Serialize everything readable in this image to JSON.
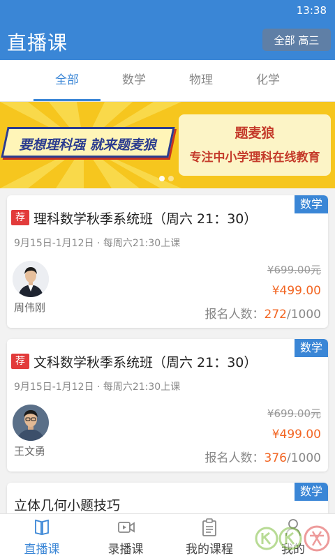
{
  "status": {
    "time": "13:38"
  },
  "header": {
    "title": "直播课",
    "filter_label": "全部 高三"
  },
  "tabs": [
    {
      "label": "全部",
      "active": true
    },
    {
      "label": "数学",
      "active": false
    },
    {
      "label": "物理",
      "active": false
    },
    {
      "label": "化学",
      "active": false
    }
  ],
  "banner": {
    "slogan": "要想理科强 就来题麦狼",
    "brand": "题麦狼",
    "tagline": "专注中小学理科在线教育",
    "slides_total": 2,
    "slide_active": 1
  },
  "courses": [
    {
      "subject": "数学",
      "recommended": "荐",
      "title": "理科数学秋季系统班（周六 21：30）",
      "date": "9月15日-1月12日 · 每周六21:30上课",
      "teacher": "周伟刚",
      "price_original": "¥699.00元",
      "price_current": "¥499.00",
      "enroll_label": "报名人数：",
      "enroll_count": "272",
      "enroll_capacity": "/1000"
    },
    {
      "subject": "数学",
      "recommended": "荐",
      "title": "文科数学秋季系统班（周六 21：30）",
      "date": "9月15日-1月12日 · 每周六21:30上课",
      "teacher": "王文勇",
      "price_original": "¥699.00元",
      "price_current": "¥499.00",
      "enroll_label": "报名人数：",
      "enroll_count": "376",
      "enroll_capacity": "/1000"
    },
    {
      "subject": "数学",
      "title": "立体几何小题技巧"
    }
  ],
  "bottom_nav": [
    {
      "label": "直播课",
      "icon": "book-icon",
      "active": true
    },
    {
      "label": "录播课",
      "icon": "video-icon",
      "active": false
    },
    {
      "label": "我的课程",
      "icon": "clipboard-icon",
      "active": false
    },
    {
      "label": "我的",
      "icon": "person-icon",
      "active": false
    }
  ],
  "colors": {
    "primary": "#3a86d6",
    "accent_price": "#f26522",
    "recommend_badge": "#e23b3b",
    "banner_bg": "#f6c61e"
  }
}
